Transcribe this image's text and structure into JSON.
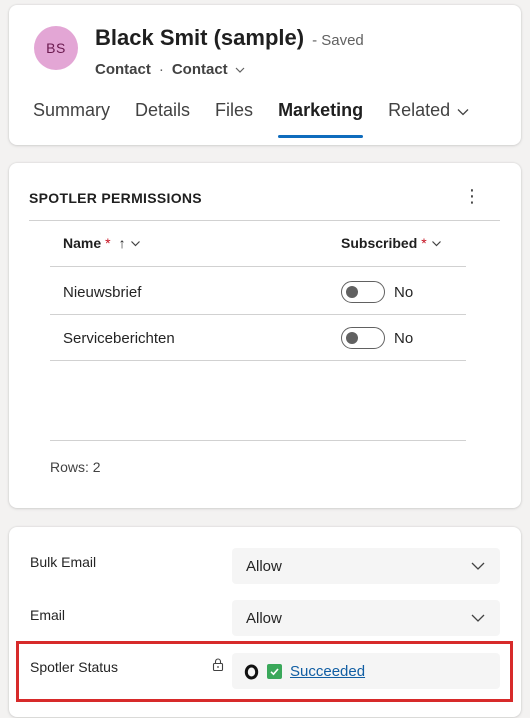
{
  "header": {
    "avatar_initials": "BS",
    "title": "Black Smit (sample)",
    "saved_status": "- Saved",
    "entity_type": "Contact",
    "dot": "·",
    "form_selector": "Contact",
    "tabs": [
      {
        "label": "Summary"
      },
      {
        "label": "Details"
      },
      {
        "label": "Files"
      },
      {
        "label": "Marketing",
        "active": true
      },
      {
        "label": "Related"
      }
    ]
  },
  "permissions": {
    "section_title": "SPOTLER PERMISSIONS",
    "more_glyph": "⋮",
    "columns": {
      "name": "Name",
      "subscribed": "Subscribed",
      "required_mark": "*",
      "sort_glyph": "↑"
    },
    "rows": [
      {
        "name": "Nieuwsbrief",
        "subscribed": "No"
      },
      {
        "name": "Serviceberichten",
        "subscribed": "No"
      }
    ],
    "rows_count": "Rows: 2"
  },
  "fields": {
    "bulk_email_label": "Bulk Email",
    "bulk_email_value": "Allow",
    "email_label": "Email",
    "email_value": "Allow",
    "spotler_status_label": "Spotler Status",
    "spotler_status_value": "Succeeded"
  },
  "colors": {
    "accent": "#0f6cbd",
    "avatar_bg": "#e3a6d5",
    "highlight": "#d72a2a",
    "success": "#3aa85a",
    "link": "#115ea3"
  }
}
